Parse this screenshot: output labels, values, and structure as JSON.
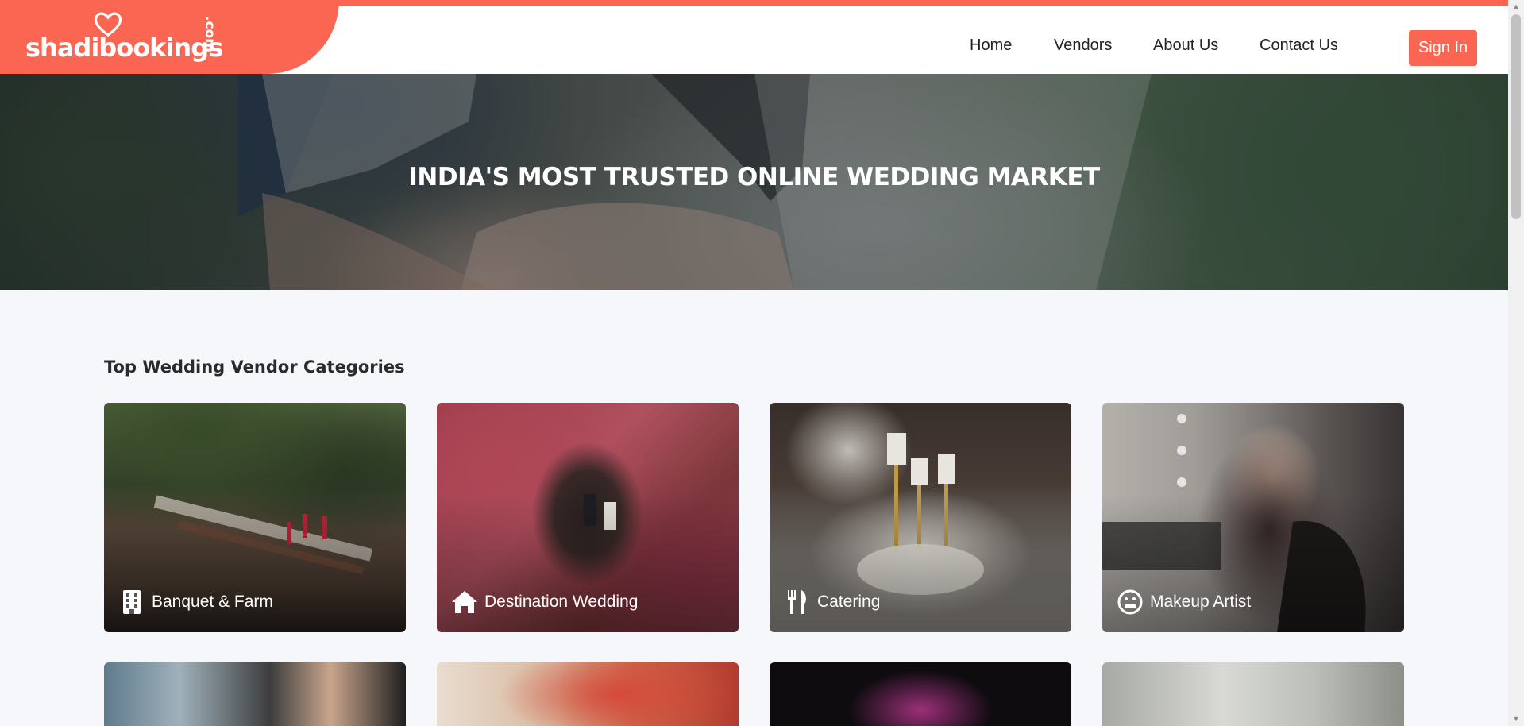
{
  "brand": {
    "name": "shadibookings",
    "tld": ".com",
    "accent": "#fa6652"
  },
  "nav": {
    "items": [
      {
        "label": "Home"
      },
      {
        "label": "Vendors"
      },
      {
        "label": "About Us"
      },
      {
        "label": "Contact Us"
      }
    ],
    "signin_label": "Sign In"
  },
  "hero": {
    "title": "INDIA'S MOST TRUSTED ONLINE WEDDING MARKET"
  },
  "categories": {
    "title": "Top Wedding Vendor Categories",
    "items": [
      {
        "label": "Banquet & Farm",
        "icon": "building-icon"
      },
      {
        "label": "Destination Wedding",
        "icon": "home-icon"
      },
      {
        "label": "Catering",
        "icon": "utensils-icon"
      },
      {
        "label": "Makeup Artist",
        "icon": "face-icon"
      }
    ]
  }
}
